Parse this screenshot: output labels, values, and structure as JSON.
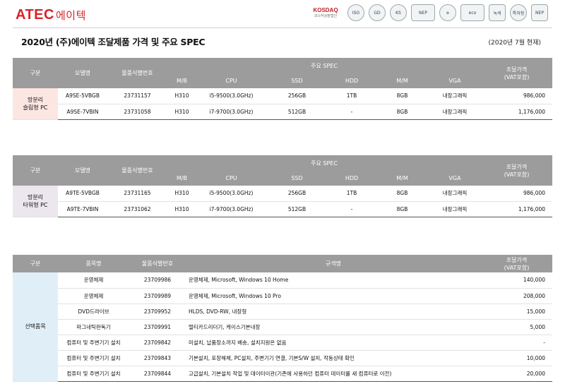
{
  "header": {
    "logo_brand": "ATEC",
    "logo_kr": "에이텍",
    "certs": [
      {
        "name": "KOSDAQ",
        "sub": "코스닥상장법인"
      },
      {
        "name": "ISO"
      },
      {
        "name": "GD"
      },
      {
        "name": "KS"
      },
      {
        "name": "NEP"
      },
      {
        "name": "e"
      },
      {
        "name": "eco"
      },
      {
        "name": "녹색"
      },
      {
        "name": "특허청"
      },
      {
        "name": "NEP"
      }
    ]
  },
  "page": {
    "title": "2020년 (주)에이텍 조달제품 가격 및 주요 SPEC",
    "as_of": "(2020년 7월 현재)"
  },
  "spec_table_headers": {
    "category": "구분",
    "model": "모델명",
    "product_id": "물품식별번호",
    "spec_group": "주요 SPEC",
    "mb": "M/B",
    "cpu": "CPU",
    "ssd": "SSD",
    "hdd": "HDD",
    "mm": "M/M",
    "vga": "VGA",
    "price_line1": "조달가격",
    "price_line2": "(VAT포함)"
  },
  "table1": {
    "category_line1": "망분리",
    "category_line2": "슬림형 PC",
    "rows": [
      {
        "model": "A9SE-5VBGB",
        "id": "23731157",
        "mb": "H310",
        "cpu": "i5-9500(3.0GHz)",
        "ssd": "256GB",
        "hdd": "1TB",
        "mm": "8GB",
        "vga": "내장그래픽",
        "price": "986,000"
      },
      {
        "model": "A9SE-7VBIN",
        "id": "23731058",
        "mb": "H310",
        "cpu": "i7-9700(3.0GHz)",
        "ssd": "512GB",
        "hdd": "-",
        "mm": "8GB",
        "vga": "내장그래픽",
        "price": "1,176,000"
      }
    ]
  },
  "table2": {
    "category_line1": "망분리",
    "category_line2": "타워형 PC",
    "rows": [
      {
        "model": "A9TE-5VBGB",
        "id": "23731165",
        "mb": "H310",
        "cpu": "i5-9500(3.0GHz)",
        "ssd": "256GB",
        "hdd": "1TB",
        "mm": "8GB",
        "vga": "내장그래픽",
        "price": "986,000"
      },
      {
        "model": "A9TE-7VBIN",
        "id": "23731062",
        "mb": "H310",
        "cpu": "i7-9700(3.0GHz)",
        "ssd": "512GB",
        "hdd": "-",
        "mm": "8GB",
        "vga": "내장그래픽",
        "price": "1,176,000"
      }
    ]
  },
  "table3": {
    "headers": {
      "category": "구분",
      "item": "품목명",
      "product_id": "물품식별번호",
      "spec": "규격명",
      "price_line1": "조달가격",
      "price_line2": "(VAT포함)"
    },
    "category": "선택품목",
    "rows": [
      {
        "item": "운영체제",
        "id": "23709986",
        "spec": "운영체제, Microsoft, Windows 10 Home",
        "price": "140,000"
      },
      {
        "item": "운영체제",
        "id": "23709989",
        "spec": "운영체제, Microsoft, Windows 10 Pro",
        "price": "208,000"
      },
      {
        "item": "DVD드라이브",
        "id": "23709952",
        "spec": "HLDS, DVD-RW, 내장형",
        "price": "15,000"
      },
      {
        "item": "마그네틱판독기",
        "id": "23709991",
        "spec": "멀티카드리더기, 케이스기본내장",
        "price": "5,000"
      },
      {
        "item": "컴퓨터 및 주변기기 설치",
        "id": "23709842",
        "spec": "미설치, 납품장소까지 배송, 설치지원은 없음",
        "price": "-"
      },
      {
        "item": "컴퓨터 및 주변기기 설치",
        "id": "23709843",
        "spec": "기본설치, 포장해체, PC설치, 주변기기 연결, 기본S/W 설치, 작동상태 확인",
        "price": "10,000"
      },
      {
        "item": "컴퓨터 및 주변기기 설치",
        "id": "23709844",
        "spec": "고급설치, 기본설치 작업 및 데이터이관(기존에 사용하던 컴퓨터 데이터를 새 컴퓨터로 이전)",
        "price": "20,000"
      }
    ]
  }
}
